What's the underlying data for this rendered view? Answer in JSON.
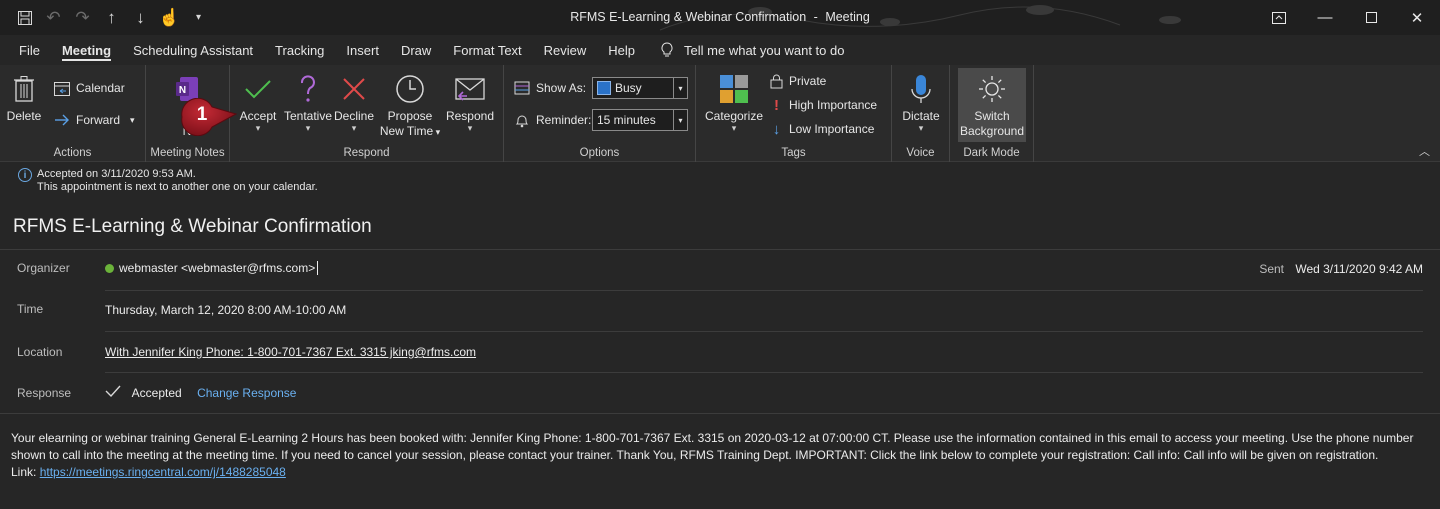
{
  "window": {
    "title": "RFMS E-Learning & Webinar Confirmation",
    "title_sep": "-",
    "app_mode": "Meeting"
  },
  "tabs": [
    {
      "label": "File"
    },
    {
      "label": "Meeting",
      "active": true
    },
    {
      "label": "Scheduling Assistant"
    },
    {
      "label": "Tracking"
    },
    {
      "label": "Insert"
    },
    {
      "label": "Draw"
    },
    {
      "label": "Format Text"
    },
    {
      "label": "Review"
    },
    {
      "label": "Help"
    }
  ],
  "tell_me": "Tell me what you want to do",
  "ribbon": {
    "actions": {
      "label": "Actions",
      "delete": "Delete",
      "calendar": "Calendar",
      "forward": "Forward"
    },
    "meeting_notes": {
      "label": "Meeting Notes",
      "btn_line1": "M",
      "btn_line2": "N"
    },
    "respond": {
      "label": "Respond",
      "accept": "Accept",
      "tentative": "Tentative",
      "decline": "Decline",
      "propose_line1": "Propose",
      "propose_line2": "New Time",
      "respond": "Respond"
    },
    "options": {
      "label": "Options",
      "show_as_label": "Show As:",
      "show_as_value": "Busy",
      "reminder_label": "Reminder:",
      "reminder_value": "15 minutes"
    },
    "tags": {
      "label": "Tags",
      "categorize": "Categorize",
      "private": "Private",
      "high": "High Importance",
      "low": "Low Importance"
    },
    "voice": {
      "label": "Voice",
      "dictate": "Dictate"
    },
    "dark_mode": {
      "label": "Dark Mode",
      "line1": "Switch",
      "line2": "Background"
    }
  },
  "callout_number": "1",
  "info": {
    "line1": "Accepted on 3/11/2020 9:53 AM.",
    "line2": "This appointment is next to another one on your calendar."
  },
  "subject": "RFMS E-Learning & Webinar Confirmation",
  "organizer": {
    "label": "Organizer",
    "value": "webmaster <webmaster@rfms.com>"
  },
  "sent": {
    "label": "Sent",
    "value": "Wed 3/11/2020 9:42 AM"
  },
  "time": {
    "label": "Time",
    "value": "Thursday, March 12, 2020 8:00 AM-10:00 AM"
  },
  "location": {
    "label": "Location",
    "value": "With Jennifer King Phone: 1-800-701-7367 Ext. 3315  jking@rfms.com"
  },
  "response": {
    "label": "Response",
    "value": "Accepted",
    "change": "Change Response"
  },
  "body": {
    "text": "Your elearning or webinar training General E-Learning 2 Hours has been booked with: Jennifer King Phone: 1-800-701-7367 Ext. 3315 on 2020-03-12 at 07:00:00 CT. Please use the information contained in this email to access your meeting. Use the phone number shown to call into the meeting at the meeting time. If you need to cancel your session, please contact your trainer. Thank You, RFMS Training Dept. IMPORTANT: Click the link below to complete your registration: Call info: Call info will be given on registration.",
    "link_label": "Link:",
    "link_url": "https://meetings.ringcentral.com/j/1488285048"
  },
  "colors": {
    "accent_accept": "#4fbf4f",
    "accent_tentative": "#b06ad8",
    "accent_decline": "#e04a4a",
    "callout": "#9a1b25"
  }
}
